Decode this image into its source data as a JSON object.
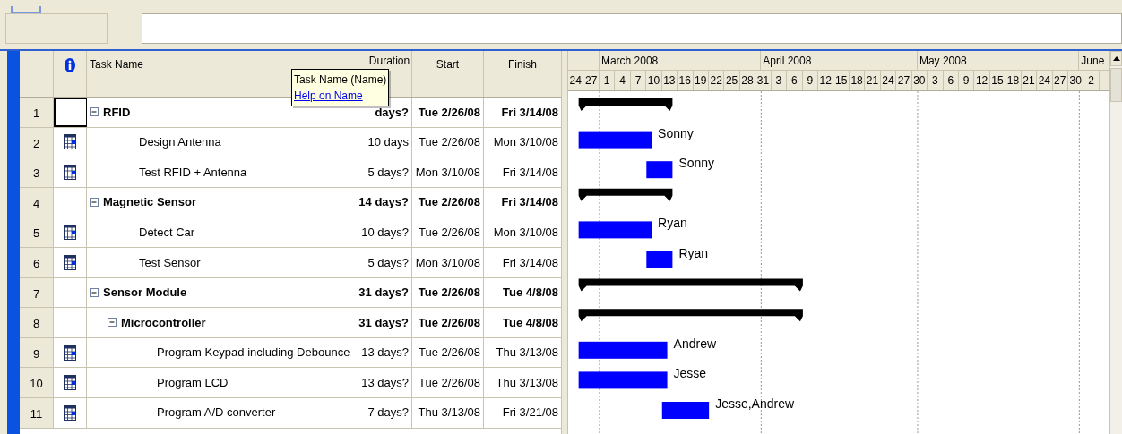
{
  "tooltip": {
    "title": "Task Name (Name)",
    "link": "Help on Name"
  },
  "columns": {
    "task_name": "Task Name",
    "duration": "Duration",
    "start": "Start",
    "finish": "Finish"
  },
  "timescale": {
    "months": [
      "March 2008",
      "April 2008",
      "May 2008",
      "June"
    ],
    "day_labels": [
      "24",
      "27",
      "1",
      "4",
      "7",
      "10",
      "13",
      "16",
      "19",
      "22",
      "25",
      "28",
      "31",
      "3",
      "6",
      "9",
      "12",
      "15",
      "18",
      "21",
      "24",
      "27",
      "30",
      "3",
      "6",
      "9",
      "12",
      "15",
      "18",
      "21",
      "24",
      "27",
      "30",
      "2"
    ]
  },
  "tasks": [
    {
      "row": "1",
      "kind": "summary",
      "name": "RFID",
      "duration": "days?",
      "start": "Tue 2/26/08",
      "finish": "Fri 3/14/08",
      "expanded": true,
      "selected": true,
      "children": [
        {
          "row": "2",
          "kind": "task",
          "name": "Design Antenna",
          "duration": "10 days",
          "start": "Tue 2/26/08",
          "finish": "Mon 3/10/08",
          "resource": "Sonny",
          "selected": false
        },
        {
          "row": "3",
          "kind": "task",
          "name": "Test RFID + Antenna",
          "duration": "5 days?",
          "start": "Mon 3/10/08",
          "finish": "Fri 3/14/08",
          "resource": "Sonny",
          "selected": false
        }
      ]
    },
    {
      "row": "4",
      "kind": "summary",
      "name": "Magnetic Sensor",
      "duration": "14 days?",
      "start": "Tue 2/26/08",
      "finish": "Fri 3/14/08",
      "expanded": true,
      "selected": false,
      "children": [
        {
          "row": "5",
          "kind": "task",
          "name": "Detect Car",
          "duration": "10 days?",
          "start": "Tue 2/26/08",
          "finish": "Mon 3/10/08",
          "resource": "Ryan",
          "selected": false
        },
        {
          "row": "6",
          "kind": "task",
          "name": "Test Sensor",
          "duration": "5 days?",
          "start": "Mon 3/10/08",
          "finish": "Fri 3/14/08",
          "resource": "Ryan",
          "selected": false
        }
      ]
    },
    {
      "row": "7",
      "kind": "summary",
      "name": "Sensor Module",
      "duration": "31 days?",
      "start": "Tue 2/26/08",
      "finish": "Tue 4/8/08",
      "expanded": true,
      "selected": false,
      "children": [
        {
          "row": "8",
          "kind": "summary",
          "name": "Microcontroller",
          "duration": "31 days?",
          "start": "Tue 2/26/08",
          "finish": "Tue 4/8/08",
          "expanded": true,
          "selected": false,
          "children": [
            {
              "row": "9",
              "kind": "task",
              "name": "Program Keypad including Debounce",
              "duration": "13 days?",
              "start": "Tue 2/26/08",
              "finish": "Thu 3/13/08",
              "resource": "Andrew",
              "selected": false
            },
            {
              "row": "10",
              "kind": "task",
              "name": "Program LCD",
              "duration": "13 days?",
              "start": "Tue 2/26/08",
              "finish": "Thu 3/13/08",
              "resource": "Jesse",
              "selected": false
            },
            {
              "row": "11",
              "kind": "task",
              "name": "Program A/D converter",
              "duration": "7 days?",
              "start": "Thu 3/13/08",
              "finish": "Fri 3/21/08",
              "resource": "Jesse,Andrew",
              "selected": false
            }
          ]
        }
      ]
    }
  ]
}
